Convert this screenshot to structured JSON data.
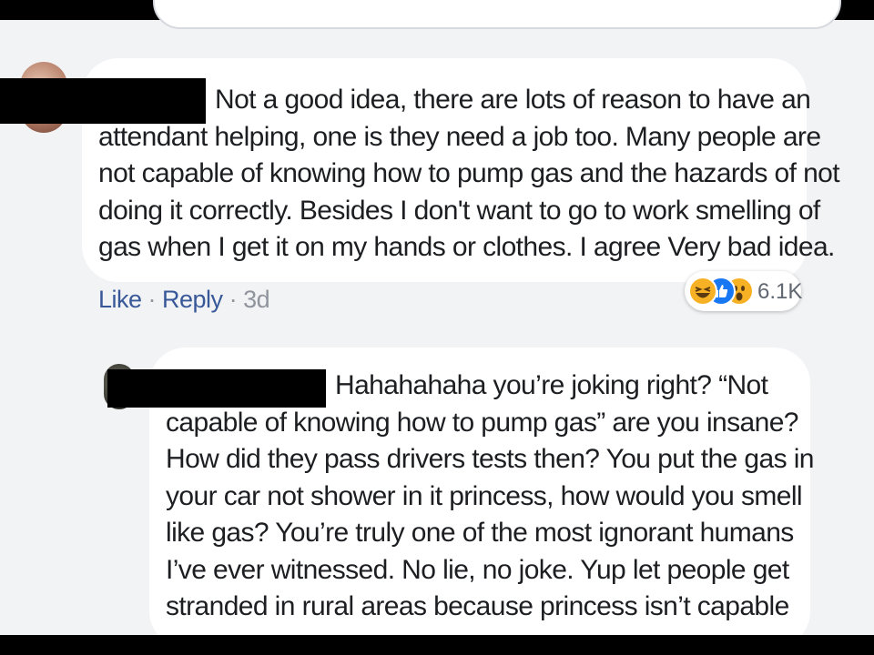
{
  "comment1": {
    "lines": [
      "Not a good idea, there are lots of reason to have an",
      "attendant helping, one is they need a job too. Many people are",
      "not capable of knowing how to pump gas and the hazards of not",
      "doing it correctly. Besides I don't want to go to work smelling of",
      "gas when I get it on my hands or clothes. I agree Very bad idea."
    ],
    "actions": {
      "like": "Like",
      "sep1": " · ",
      "reply": "Reply",
      "sep2": " · ",
      "time": "3d"
    },
    "reactions": {
      "icons": [
        "haha-icon",
        "like-icon",
        "wow-icon"
      ],
      "count": "6.1K"
    }
  },
  "comment2": {
    "lines": [
      "Hahahahaha you’re joking right? “Not",
      "capable of knowing how to pump gas” are you insane?",
      "How did they pass drivers tests then? You put the gas in",
      "your car not shower in it princess, how would you smell",
      "like gas? You’re truly one of the most ignorant humans",
      "I’ve ever witnessed. No lie, no joke. Yup let people get",
      "stranded in rural areas because princess isn’t capable"
    ]
  },
  "colors": {
    "link": "#385898",
    "meta": "#90949c",
    "text": "#1c1e21",
    "background": "#f2f3f5"
  }
}
